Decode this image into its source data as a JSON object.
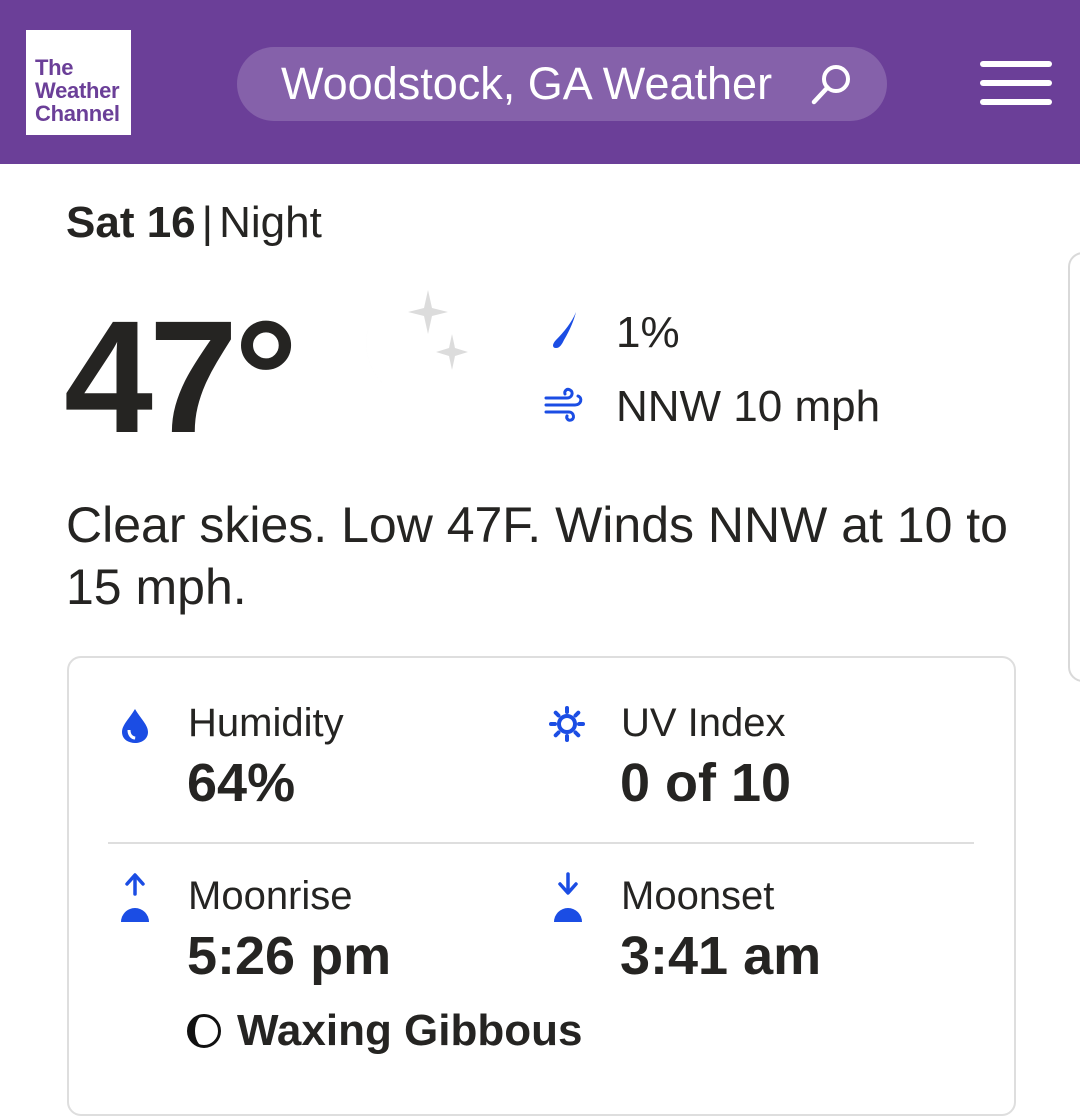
{
  "header": {
    "logo_line1": "The",
    "logo_line2": "Weather",
    "logo_line3": "Channel",
    "search_text": "Woodstock, GA Weather",
    "search_icon": "search-icon",
    "menu_icon": "hamburger-menu-icon",
    "background_color": "#6b3f98"
  },
  "forecast": {
    "day": "Sat 16",
    "separator": "|",
    "period": "Night",
    "temperature": "47°",
    "condition_icon": "moon-stars-icon",
    "precip_chance": "1%",
    "wind": "NNW 10 mph",
    "narrative": "Clear skies. Low 47F. Winds NNW at 10 to 15 mph."
  },
  "details": {
    "humidity": {
      "label": "Humidity",
      "value": "64%",
      "icon": "humidity-drop-icon"
    },
    "uv_index": {
      "label": "UV Index",
      "value": "0 of 10",
      "icon": "uv-sun-icon"
    },
    "moonrise": {
      "label": "Moonrise",
      "value": "5:26 pm",
      "icon": "moonrise-icon"
    },
    "moonset": {
      "label": "Moonset",
      "value": "3:41 am",
      "icon": "moonset-icon"
    },
    "moon_phase": {
      "value": "Waxing Gibbous",
      "icon": "moon-phase-icon"
    }
  },
  "colors": {
    "accent_blue": "#1b4de4",
    "text": "#252422",
    "icon_gray": "#dcdcdc"
  }
}
